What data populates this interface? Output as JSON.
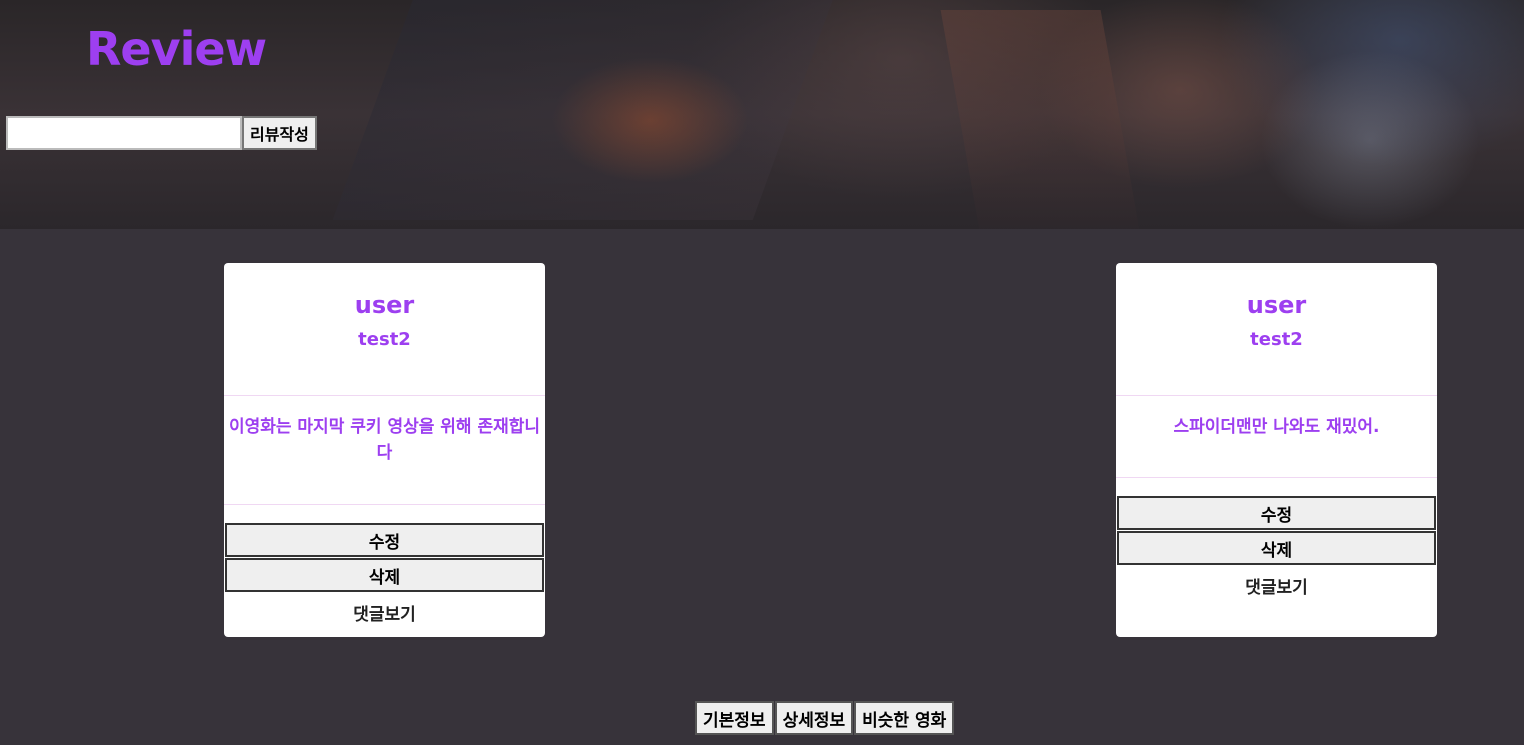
{
  "header": {
    "title": "Review",
    "search": {
      "value": "",
      "placeholder": ""
    },
    "write_review_label": "리뷰작성"
  },
  "reviews": [
    {
      "user_label": "user",
      "user_id": "test2",
      "content": "이영화는 마지막 쿠키 영상을 위해 존재합니다",
      "edit_label": "수정",
      "delete_label": "삭제",
      "comments_label": "댓글보기"
    },
    {
      "user_label": "user",
      "user_id": "test2",
      "content": "스파이더맨만 나와도 재밌어.",
      "edit_label": "수정",
      "delete_label": "삭제",
      "comments_label": "댓글보기"
    }
  ],
  "bottom_nav": {
    "basic_info": "기본정보",
    "detail_info": "상세정보",
    "similar_movies": "비슷한 영화"
  },
  "colors": {
    "accent": "#9d3ff0",
    "background": "#37333a",
    "card": "#ffffff"
  }
}
